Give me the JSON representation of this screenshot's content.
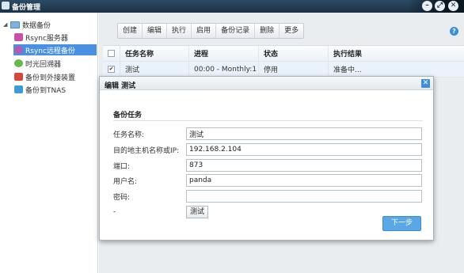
{
  "window": {
    "title": "备份管理"
  },
  "sidebar": {
    "root_label": "数据备份",
    "items": [
      {
        "label": "Rsync服务器",
        "icon": "rsync-server-icon"
      },
      {
        "label": "Rsync远程备份",
        "icon": "remote-backup-icon",
        "selected": true
      },
      {
        "label": "时光回溯器",
        "icon": "time-machine-icon"
      },
      {
        "label": "备份到外接装置",
        "icon": "external-device-icon"
      },
      {
        "label": "备份到TNAS",
        "icon": "tnas-icon"
      }
    ]
  },
  "toolbar": {
    "buttons": [
      "创建",
      "编辑",
      "执行",
      "启用",
      "备份记录",
      "删除",
      "更多"
    ]
  },
  "help_icon": "?",
  "table": {
    "headers": [
      "任务名称",
      "进程",
      "状态",
      "执行结果"
    ],
    "rows": [
      {
        "checked": "✔",
        "name": "测试",
        "progress": "00:00 - Monthly:1",
        "state": "停用",
        "result": "准备中..."
      }
    ]
  },
  "modal": {
    "title": "编辑 测试",
    "close": "✕",
    "section": "备份任务",
    "fields": [
      {
        "label": "任务名称:",
        "value": "测试"
      },
      {
        "label": "目的地主机名称或IP:",
        "value": "192.168.2.104"
      },
      {
        "label": "端口:",
        "value": "873"
      },
      {
        "label": "用户名:",
        "value": "panda"
      },
      {
        "label": "密码:",
        "value": ""
      }
    ],
    "test_label": "-",
    "test_button": "测试",
    "next_button": "下一步"
  },
  "colors": {
    "accent": "#4a90e2",
    "titlebar": "#1b3247",
    "primary_button": "#5aa7e8"
  }
}
